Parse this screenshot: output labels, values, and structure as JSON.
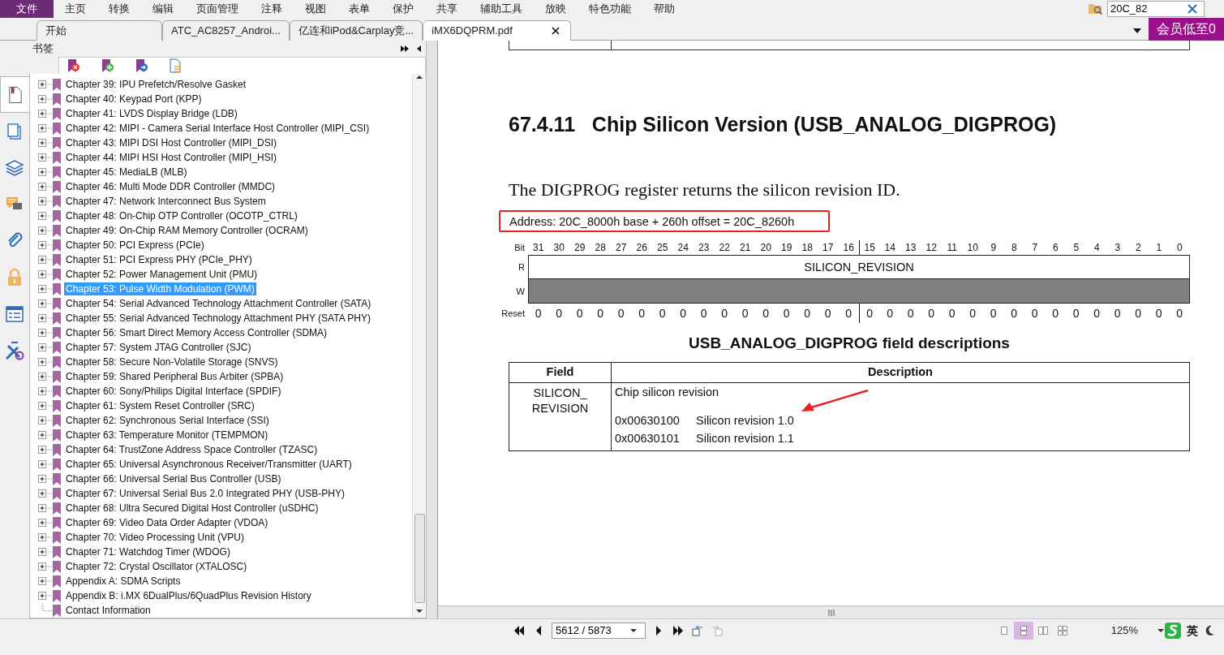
{
  "menu": [
    {
      "label": "文件",
      "selected": true
    },
    {
      "label": "主页",
      "selected": false
    },
    {
      "label": "转换",
      "selected": false
    },
    {
      "label": "编辑",
      "selected": false
    },
    {
      "label": "页面管理",
      "selected": false
    },
    {
      "label": "注释",
      "selected": false
    },
    {
      "label": "视图",
      "selected": false
    },
    {
      "label": "表单",
      "selected": false
    },
    {
      "label": "保护",
      "selected": false
    },
    {
      "label": "共享",
      "selected": false
    },
    {
      "label": "辅助工具",
      "selected": false
    },
    {
      "label": "放映",
      "selected": false
    },
    {
      "label": "特色功能",
      "selected": false
    },
    {
      "label": "帮助",
      "selected": false
    }
  ],
  "search": {
    "value": "20C_82"
  },
  "tabs": [
    {
      "label": "开始",
      "selected": false
    },
    {
      "label": "ATC_AC8257_Androi...",
      "selected": false
    },
    {
      "label": "亿连和iPod&Carplay竞...",
      "selected": false
    },
    {
      "label": "iMX6DQPRM.pdf",
      "selected": true
    }
  ],
  "promo_button": "会员低至0",
  "sidebar_tabs": [
    {
      "kind": "bookmarks",
      "selected": true
    },
    {
      "kind": "pages",
      "selected": false
    },
    {
      "kind": "layers",
      "selected": false
    },
    {
      "kind": "comments",
      "selected": false
    },
    {
      "kind": "attachments",
      "selected": false
    },
    {
      "kind": "security",
      "selected": false
    },
    {
      "kind": "forms",
      "selected": false
    },
    {
      "kind": "signatures",
      "selected": false
    }
  ],
  "bookmarks_panel": {
    "title": "书签",
    "items": [
      {
        "label": "Chapter 39: IPU Prefetch/Resolve Gasket",
        "expandable": true,
        "selected": false
      },
      {
        "label": "Chapter 40: Keypad Port (KPP)",
        "expandable": true,
        "selected": false
      },
      {
        "label": "Chapter 41: LVDS Display Bridge (LDB)",
        "expandable": true,
        "selected": false
      },
      {
        "label": "Chapter 42: MIPI - Camera Serial Interface Host Controller (MIPI_CSI)",
        "expandable": true,
        "selected": false
      },
      {
        "label": "Chapter 43: MIPI DSI Host Controller (MIPI_DSI)",
        "expandable": true,
        "selected": false
      },
      {
        "label": "Chapter 44: MIPI HSI Host Controller (MIPI_HSI)",
        "expandable": true,
        "selected": false
      },
      {
        "label": "Chapter 45: MediaLB (MLB)",
        "expandable": true,
        "selected": false
      },
      {
        "label": "Chapter 46: Multi Mode DDR Controller (MMDC)",
        "expandable": true,
        "selected": false
      },
      {
        "label": "Chapter 47: Network Interconnect Bus System",
        "expandable": true,
        "selected": false
      },
      {
        "label": "Chapter 48: On-Chip OTP Controller (OCOTP_CTRL)",
        "expandable": true,
        "selected": false
      },
      {
        "label": "Chapter 49: On-Chip RAM Memory Controller (OCRAM)",
        "expandable": true,
        "selected": false
      },
      {
        "label": "Chapter 50: PCI Express (PCIe)",
        "expandable": true,
        "selected": false
      },
      {
        "label": "Chapter 51: PCI Express PHY (PCIe_PHY)",
        "expandable": true,
        "selected": false
      },
      {
        "label": "Chapter 52: Power Management Unit (PMU)",
        "expandable": true,
        "selected": false
      },
      {
        "label": "Chapter 53: Pulse Width Modulation (PWM)",
        "expandable": true,
        "selected": true
      },
      {
        "label": "Chapter 54: Serial Advanced Technology Attachment Controller (SATA)",
        "expandable": true,
        "selected": false
      },
      {
        "label": "Chapter 55: Serial Advanced Technology Attachment PHY (SATA PHY)",
        "expandable": true,
        "selected": false
      },
      {
        "label": "Chapter 56: Smart Direct Memory Access Controller (SDMA)",
        "expandable": true,
        "selected": false
      },
      {
        "label": "Chapter 57: System JTAG Controller (SJC)",
        "expandable": true,
        "selected": false
      },
      {
        "label": "Chapter 58: Secure Non-Volatile Storage (SNVS)",
        "expandable": true,
        "selected": false
      },
      {
        "label": "Chapter 59: Shared Peripheral Bus Arbiter (SPBA)",
        "expandable": true,
        "selected": false
      },
      {
        "label": "Chapter 60: Sony/Philips Digital Interface (SPDIF)",
        "expandable": true,
        "selected": false
      },
      {
        "label": "Chapter 61: System Reset Controller (SRC)",
        "expandable": true,
        "selected": false
      },
      {
        "label": "Chapter 62: Synchronous Serial Interface (SSI)",
        "expandable": true,
        "selected": false
      },
      {
        "label": "Chapter 63: Temperature Monitor (TEMPMON)",
        "expandable": true,
        "selected": false
      },
      {
        "label": "Chapter 64: TrustZone Address Space Controller (TZASC)",
        "expandable": true,
        "selected": false
      },
      {
        "label": "Chapter 65: Universal Asynchronous Receiver/Transmitter (UART)",
        "expandable": true,
        "selected": false
      },
      {
        "label": "Chapter 66: Universal Serial Bus Controller (USB)",
        "expandable": true,
        "selected": false
      },
      {
        "label": "Chapter 67: Universal Serial Bus 2.0 Integrated PHY (USB-PHY)",
        "expandable": true,
        "selected": false
      },
      {
        "label": "Chapter 68: Ultra Secured Digital Host Controller (uSDHC)",
        "expandable": true,
        "selected": false
      },
      {
        "label": "Chapter 69: Video Data Order Adapter (VDOA)",
        "expandable": true,
        "selected": false
      },
      {
        "label": "Chapter 70: Video Processing Unit (VPU)",
        "expandable": true,
        "selected": false
      },
      {
        "label": "Chapter 71: Watchdog Timer (WDOG)",
        "expandable": true,
        "selected": false
      },
      {
        "label": "Chapter 72: Crystal Oscillator (XTALOSC)",
        "expandable": true,
        "selected": false
      },
      {
        "label": "Appendix A: SDMA Scripts",
        "expandable": true,
        "selected": false
      },
      {
        "label": "Appendix B: i.MX 6DualPlus/6QuadPlus Revision History",
        "expandable": true,
        "selected": false
      },
      {
        "label": "Contact Information",
        "expandable": false,
        "selected": false
      }
    ]
  },
  "document": {
    "heading": "67.4.11   Chip Silicon Version (USB_ANALOG_DIGPROG)",
    "paragraph": "The DIGPROG register returns the silicon revision ID.",
    "address": {
      "text": "Address: 20C_8000h base + 260h offset = 20C_8260h",
      "highlighted": true
    },
    "register": {
      "bit_label": "Bit",
      "bits": [
        "31",
        "30",
        "29",
        "28",
        "27",
        "26",
        "25",
        "24",
        "23",
        "22",
        "21",
        "20",
        "19",
        "18",
        "17",
        "16",
        "15",
        "14",
        "13",
        "12",
        "11",
        "10",
        "9",
        "8",
        "7",
        "6",
        "5",
        "4",
        "3",
        "2",
        "1",
        "0"
      ],
      "rows": [
        {
          "label": "R",
          "field": "SILICON_REVISION",
          "shaded": false
        },
        {
          "label": "W",
          "shaded": true
        }
      ],
      "reset_label": "Reset",
      "reset": [
        "0",
        "0",
        "0",
        "0",
        "0",
        "0",
        "0",
        "0",
        "0",
        "0",
        "0",
        "0",
        "0",
        "0",
        "0",
        "0",
        "0",
        "0",
        "0",
        "0",
        "0",
        "0",
        "0",
        "0",
        "0",
        "0",
        "0",
        "0",
        "0",
        "0",
        "0",
        "0"
      ]
    },
    "table_title": "USB_ANALOG_DIGPROG field descriptions",
    "table": {
      "columns": [
        "Field",
        "Description"
      ],
      "rows": [
        {
          "field": "SILICON_ REVISION",
          "description": "Chip silicon revision",
          "values": [
            {
              "code": "0x00630100",
              "meaning": "Silicon revision 1.0",
              "marked": true
            },
            {
              "code": "0x00630101",
              "meaning": "Silicon revision 1.1",
              "marked": false
            }
          ]
        }
      ]
    }
  },
  "status_bar": {
    "page": "5612 / 5873",
    "view_modes": [
      {
        "kind": "single",
        "selected": false
      },
      {
        "kind": "continuous",
        "selected": true
      },
      {
        "kind": "facing",
        "selected": false
      },
      {
        "kind": "continuous-facing",
        "selected": false
      }
    ],
    "zoom": "125%",
    "ime": "英"
  }
}
